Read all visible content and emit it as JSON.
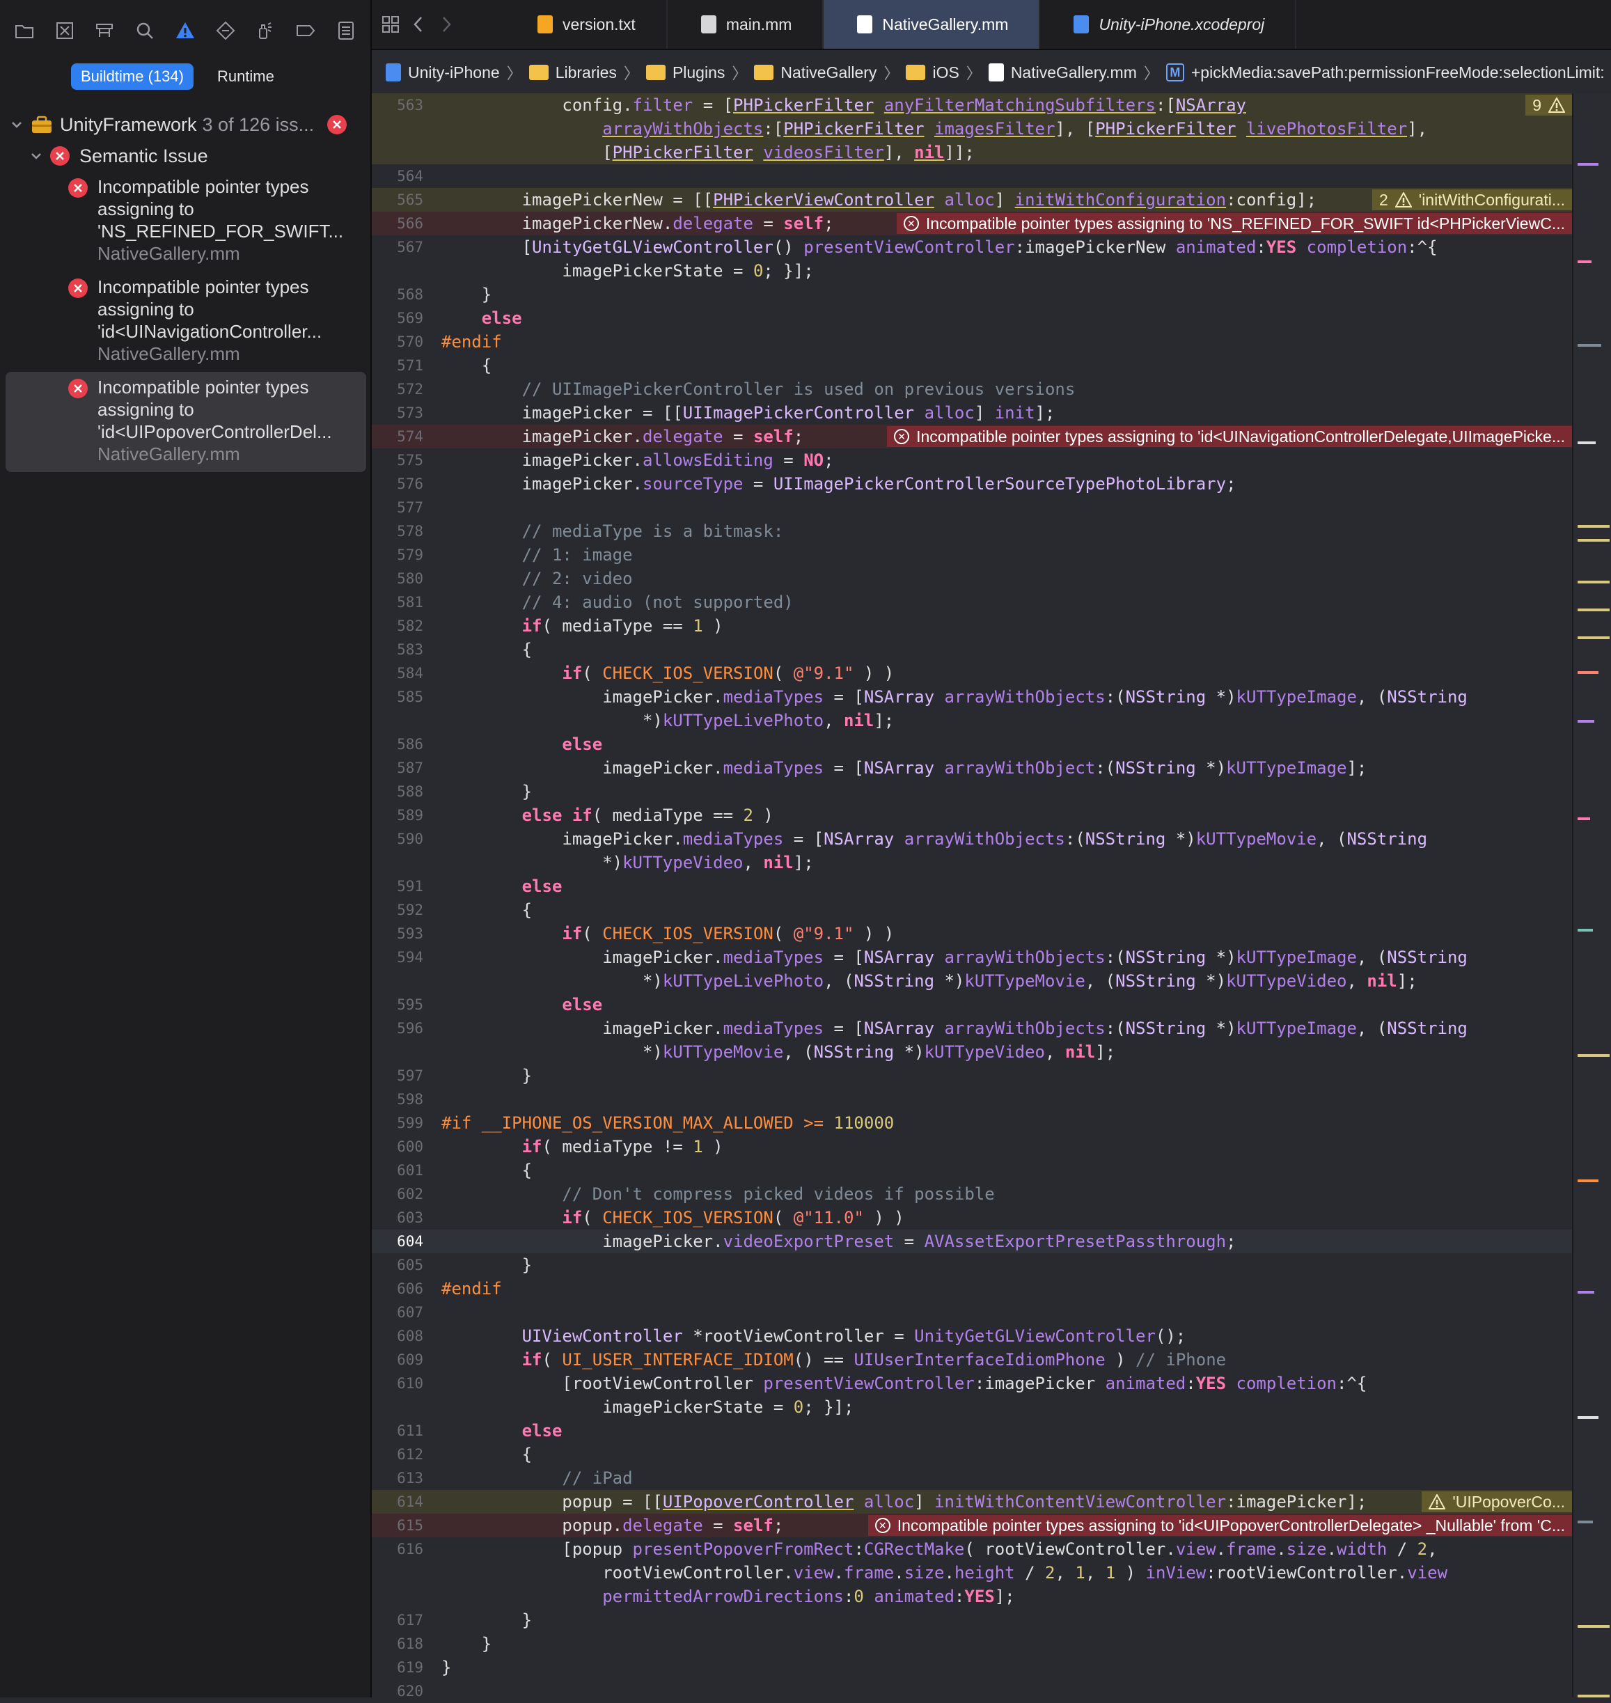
{
  "navigator": {
    "filters": {
      "buildtime": "Buildtime (134)",
      "runtime": "Runtime"
    },
    "group": {
      "name": "UnityFramework",
      "count": "3 of 126 iss..."
    },
    "category": "Semantic Issue",
    "issues": [
      {
        "line1": "Incompatible pointer types",
        "line2": "assigning to",
        "line3": "'NS_REFINED_FOR_SWIFT...",
        "file": "NativeGallery.mm"
      },
      {
        "line1": "Incompatible pointer types",
        "line2": "assigning to",
        "line3": "'id<UINavigationController...",
        "file": "NativeGallery.mm"
      },
      {
        "line1": "Incompatible pointer types",
        "line2": "assigning to",
        "line3": "'id<UIPopoverControllerDel...",
        "file": "NativeGallery.mm"
      }
    ]
  },
  "tabs": [
    {
      "label": "version.txt",
      "icon_color": "#f5a623"
    },
    {
      "label": "main.mm",
      "icon_color": "#d6d6d8"
    },
    {
      "label": "NativeGallery.mm",
      "icon_color": "#ffffff"
    },
    {
      "label": "Unity-iPhone.xcodeproj",
      "icon_color": "#4a8cf0"
    }
  ],
  "jumpbar": {
    "project": "Unity-iPhone",
    "folders": [
      "Libraries",
      "Plugins",
      "NativeGallery",
      "iOS"
    ],
    "file": "NativeGallery.mm",
    "symbol_badge": "M",
    "symbol": "+pickMedia:savePath:permissionFreeMode:selectionLimit:"
  },
  "annotations": {
    "563": {
      "count": "9"
    },
    "565": {
      "count": "2",
      "message": "'initWithConfigurati..."
    },
    "566": {
      "message": "Incompatible pointer types assigning to 'NS_REFINED_FOR_SWIFT id<PHPickerViewC..."
    },
    "574": {
      "message": "Incompatible pointer types assigning to 'id<UINavigationControllerDelegate,UIImagePicke..."
    },
    "614": {
      "message": "'UIPopoverCo..."
    },
    "615": {
      "message": "Incompatible pointer types assigning to 'id<UIPopoverControllerDelegate> _Nullable' from 'C..."
    }
  },
  "code": {
    "563": [
      "            config.",
      "filter",
      " = [",
      "PHPickerFilter",
      " ",
      "anyFilterMatchingSubfilters",
      ":[",
      "NSArray",
      "\n                ",
      "arrayWithObjects",
      ":[",
      "PHPickerFilter",
      " ",
      "imagesFilter",
      "], [",
      "PHPickerFilter",
      " ",
      "livePhotosFilter",
      "],\n                [",
      "PHPickerFilter",
      " ",
      "videosFilter",
      "], ",
      "nil",
      "]];"
    ],
    "564": [
      ""
    ],
    "565": [
      "        imagePickerNew = [[",
      "PHPickerViewController",
      " ",
      "alloc",
      "] ",
      "initWithConfiguration",
      ":config];"
    ],
    "566": [
      "        imagePickerNew.",
      "delegate",
      " = ",
      "self",
      ";"
    ],
    "567": [
      "        [",
      "UnityGetGLViewController",
      "() ",
      "presentViewController",
      ":imagePickerNew ",
      "animated",
      ":",
      "YES",
      " ",
      "completion",
      ":^{\n            imagePickerState = ",
      "0",
      "; }];"
    ],
    "568": [
      "    }"
    ],
    "569": [
      "    ",
      "else"
    ],
    "570": [
      "#endif"
    ],
    "571": [
      "    {"
    ],
    "572": [
      "        ",
      "// UIImagePickerController is used on previous versions"
    ],
    "573": [
      "        imagePicker = [[",
      "UIImagePickerController",
      " ",
      "alloc",
      "] ",
      "init",
      "];"
    ],
    "574": [
      "        imagePicker.",
      "delegate",
      " = ",
      "self",
      ";"
    ],
    "575": [
      "        imagePicker.",
      "allowsEditing",
      " = ",
      "NO",
      ";"
    ],
    "576": [
      "        imagePicker.",
      "sourceType",
      " = ",
      "UIImagePickerControllerSourceTypePhotoLibrary",
      ";"
    ],
    "577": [
      ""
    ],
    "578": [
      "        ",
      "// mediaType is a bitmask:"
    ],
    "579": [
      "        ",
      "// 1: image"
    ],
    "580": [
      "        ",
      "// 2: video"
    ],
    "581": [
      "        ",
      "// 4: audio (not supported)"
    ],
    "582": [
      "        ",
      "if",
      "( mediaType == ",
      "1",
      " )"
    ],
    "583": [
      "        {"
    ],
    "584": [
      "            ",
      "if",
      "( ",
      "CHECK_IOS_VERSION",
      "( ",
      "@\"9.1\"",
      " ) )"
    ],
    "585": [
      "                imagePicker.",
      "mediaTypes",
      " = [",
      "NSArray",
      " ",
      "arrayWithObjects",
      ":(",
      "NSString",
      " *)",
      "kUTTypeImage",
      ", (",
      "NSString",
      "\n                    *)",
      "kUTTypeLivePhoto",
      ", ",
      "nil",
      "];"
    ],
    "586": [
      "            ",
      "else"
    ],
    "587": [
      "                imagePicker.",
      "mediaTypes",
      " = [",
      "NSArray",
      " ",
      "arrayWithObject",
      ":(",
      "NSString",
      " *)",
      "kUTTypeImage",
      "];"
    ],
    "588": [
      "        }"
    ],
    "589": [
      "        ",
      "else if",
      "( mediaType == ",
      "2",
      " )"
    ],
    "590": [
      "            imagePicker.",
      "mediaTypes",
      " = [",
      "NSArray",
      " ",
      "arrayWithObjects",
      ":(",
      "NSString",
      " *)",
      "kUTTypeMovie",
      ", (",
      "NSString",
      "\n                *)",
      "kUTTypeVideo",
      ", ",
      "nil",
      "];"
    ],
    "591": [
      "        ",
      "else"
    ],
    "592": [
      "        {"
    ],
    "593": [
      "            ",
      "if",
      "( ",
      "CHECK_IOS_VERSION",
      "( ",
      "@\"9.1\"",
      " ) )"
    ],
    "594": [
      "                imagePicker.",
      "mediaTypes",
      " = [",
      "NSArray",
      " ",
      "arrayWithObjects",
      ":(",
      "NSString",
      " *)",
      "kUTTypeImage",
      ", (",
      "NSString",
      "\n                    *)",
      "kUTTypeLivePhoto",
      ", (",
      "NSString",
      " *)",
      "kUTTypeMovie",
      ", (",
      "NSString",
      " *)",
      "kUTTypeVideo",
      ", ",
      "nil",
      "];"
    ],
    "595": [
      "            ",
      "else"
    ],
    "596": [
      "                imagePicker.",
      "mediaTypes",
      " = [",
      "NSArray",
      " ",
      "arrayWithObjects",
      ":(",
      "NSString",
      " *)",
      "kUTTypeImage",
      ", (",
      "NSString",
      "\n                    *)",
      "kUTTypeMovie",
      ", (",
      "NSString",
      " *)",
      "kUTTypeVideo",
      ", ",
      "nil",
      "];"
    ],
    "597": [
      "        }"
    ],
    "598": [
      ""
    ],
    "599": [
      "#if __IPHONE_OS_VERSION_MAX_ALLOWED >= ",
      "110000"
    ],
    "600": [
      "        ",
      "if",
      "( mediaType != ",
      "1",
      " )"
    ],
    "601": [
      "        {"
    ],
    "602": [
      "            ",
      "// Don't compress picked videos if possible"
    ],
    "603": [
      "            ",
      "if",
      "( ",
      "CHECK_IOS_VERSION",
      "( ",
      "@\"11.0\"",
      " ) )"
    ],
    "604": [
      "                imagePicker.",
      "videoExportPreset",
      " = ",
      "AVAssetExportPresetPassthrough",
      ";"
    ],
    "605": [
      "        }"
    ],
    "606": [
      "#endif"
    ],
    "607": [
      ""
    ],
    "608": [
      "        ",
      "UIViewController",
      " *rootViewController = ",
      "UnityGetGLViewController",
      "();"
    ],
    "609": [
      "        ",
      "if",
      "( ",
      "UI_USER_INTERFACE_IDIOM",
      "() == ",
      "UIUserInterfaceIdiomPhone",
      " ) ",
      "// iPhone"
    ],
    "610": [
      "            [rootViewController ",
      "presentViewController",
      ":imagePicker ",
      "animated",
      ":",
      "YES",
      " ",
      "completion",
      ":^{\n                imagePickerState = ",
      "0",
      "; }];"
    ],
    "611": [
      "        ",
      "else"
    ],
    "612": [
      "        {"
    ],
    "613": [
      "            ",
      "// iPad"
    ],
    "614": [
      "            popup = [[",
      "UIPopoverController",
      " ",
      "alloc",
      "] ",
      "initWithContentViewController",
      ":imagePicker];"
    ],
    "615": [
      "            popup.",
      "delegate",
      " = ",
      "self",
      ";"
    ],
    "616": [
      "            [popup ",
      "presentPopoverFromRect",
      ":",
      "CGRectMake",
      "( rootViewController.",
      "view",
      ".",
      "frame",
      ".",
      "size",
      ".",
      "width",
      " / ",
      "2",
      ",\n                rootViewController.",
      "view",
      ".",
      "frame",
      ".",
      "size",
      ".",
      "height",
      " / ",
      "2",
      ", ",
      "1",
      ", ",
      "1",
      " ) ",
      "inView",
      ":rootViewController.",
      "view",
      "\n                ",
      "permittedArrowDirections",
      ":",
      "0",
      " ",
      "animated",
      ":",
      "YES",
      "];"
    ],
    "617": [
      "        }"
    ],
    "618": [
      "    }"
    ],
    "619": [
      "}"
    ],
    "620": [
      ""
    ]
  },
  "line_order": [
    "563",
    "564",
    "565",
    "566",
    "567",
    "568",
    "569",
    "570",
    "571",
    "572",
    "573",
    "574",
    "575",
    "576",
    "577",
    "578",
    "579",
    "580",
    "581",
    "582",
    "583",
    "584",
    "585",
    "586",
    "587",
    "588",
    "589",
    "590",
    "591",
    "592",
    "593",
    "594",
    "595",
    "596",
    "597",
    "598",
    "599",
    "600",
    "601",
    "602",
    "603",
    "604",
    "605",
    "606",
    "607",
    "608",
    "609",
    "610",
    "611",
    "612",
    "613",
    "614",
    "615",
    "616",
    "617",
    "618",
    "619",
    "620"
  ],
  "current_line": "604"
}
